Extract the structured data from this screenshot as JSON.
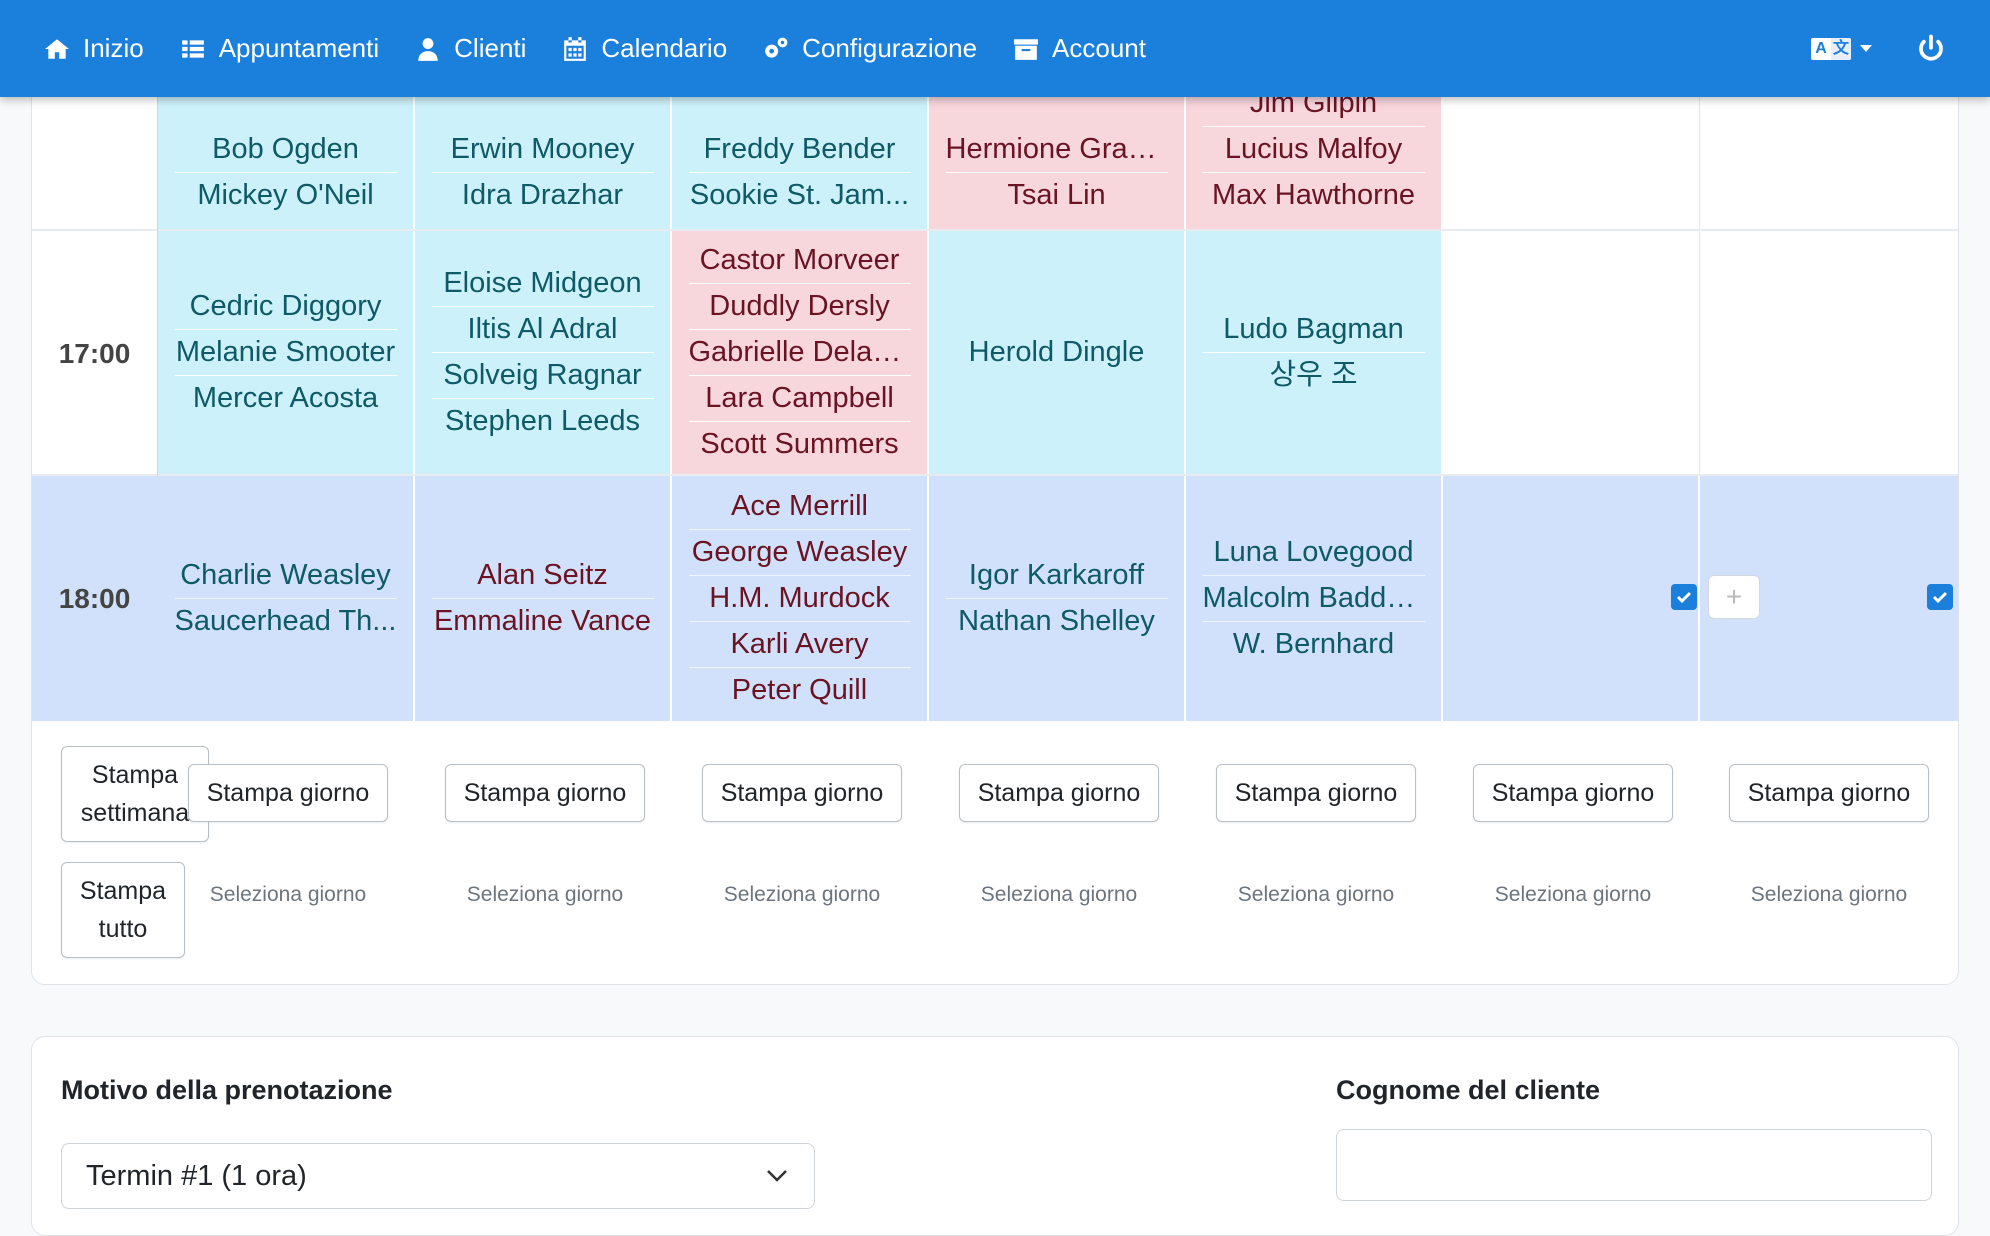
{
  "nav": {
    "items": [
      {
        "label": "Inizio",
        "icon": "home-icon"
      },
      {
        "label": "Appuntamenti",
        "icon": "list-icon"
      },
      {
        "label": "Clienti",
        "icon": "user-icon"
      },
      {
        "label": "Calendario",
        "icon": "calendar-icon"
      },
      {
        "label": "Configurazione",
        "icon": "gears-icon"
      },
      {
        "label": "Account",
        "icon": "archive-icon"
      }
    ],
    "language_icon": "language-icon",
    "power_icon": "power-icon"
  },
  "schedule": {
    "rows": [
      {
        "time": "",
        "cells": [
          {
            "color": "cyan",
            "names": [
              "Bob Ogden",
              "Mickey O'Neil"
            ]
          },
          {
            "color": "cyan",
            "names": [
              "Erwin Mooney",
              "Idra Drazhar"
            ]
          },
          {
            "color": "cyan",
            "names": [
              "Freddy Bender",
              "Sookie St. Jam..."
            ]
          },
          {
            "color": "pink",
            "names": [
              "Hermione Gran...",
              "Tsai Lin"
            ]
          },
          {
            "color": "pink",
            "names": [
              "Jim Gilpin",
              "Lucius Malfoy",
              "Max Hawthorne"
            ]
          },
          {
            "color": "white",
            "names": []
          },
          {
            "color": "white",
            "names": []
          }
        ]
      },
      {
        "time": "17:00",
        "cells": [
          {
            "color": "cyan",
            "names": [
              "Cedric Diggory",
              "Melanie Smooter",
              "Mercer Acosta"
            ]
          },
          {
            "color": "cyan",
            "names": [
              "Eloise Midgeon",
              "Iltis Al Adral",
              "Solveig Ragnar",
              "Stephen Leeds"
            ]
          },
          {
            "color": "pink",
            "names": [
              "Castor Morveer",
              "Duddly Dersly",
              "Gabrielle Delac...",
              "Lara Campbell",
              "Scott Summers"
            ]
          },
          {
            "color": "cyan",
            "names": [
              "Herold Dingle"
            ]
          },
          {
            "color": "cyan",
            "names": [
              "Ludo Bagman",
              "상우 조"
            ]
          },
          {
            "color": "white",
            "names": []
          },
          {
            "color": "white",
            "names": []
          }
        ]
      },
      {
        "time": "18:00",
        "cells": [
          {
            "color": "cyan",
            "names": [
              "Charlie Weasley",
              "Saucerhead Th..."
            ]
          },
          {
            "color": "pink",
            "names": [
              "Alan Seitz",
              "Emmaline Vance"
            ]
          },
          {
            "color": "pink",
            "names": [
              "Ace Merrill",
              "George Weasley",
              "H.M. Murdock",
              "Karli Avery",
              "Peter Quill"
            ]
          },
          {
            "color": "cyan",
            "names": [
              "Igor Karkaroff",
              "Nathan Shelley"
            ]
          },
          {
            "color": "cyan",
            "names": [
              "Luna Lovegood",
              "Malcolm Baddo...",
              "W. Bernhard"
            ]
          },
          {
            "color": "white",
            "names": []
          },
          {
            "color": "white",
            "names": []
          }
        ]
      }
    ],
    "add_button": "+"
  },
  "footer": {
    "print_week": "Stampa settimana",
    "print_all": "Stampa tutto",
    "print_day": "Stampa giorno",
    "select_day": "Seleziona giorno"
  },
  "form": {
    "reason_label": "Motivo della prenotazione",
    "reason_value": "Termin #1 (1 ora)",
    "surname_label": "Cognome del cliente",
    "surname_value": ""
  },
  "colors": {
    "navbar": "#1b7fdc",
    "cyan_cell": "#ccf1fa",
    "pink_cell": "#f7d6dc",
    "highlight_row": "#d1e1fb"
  }
}
